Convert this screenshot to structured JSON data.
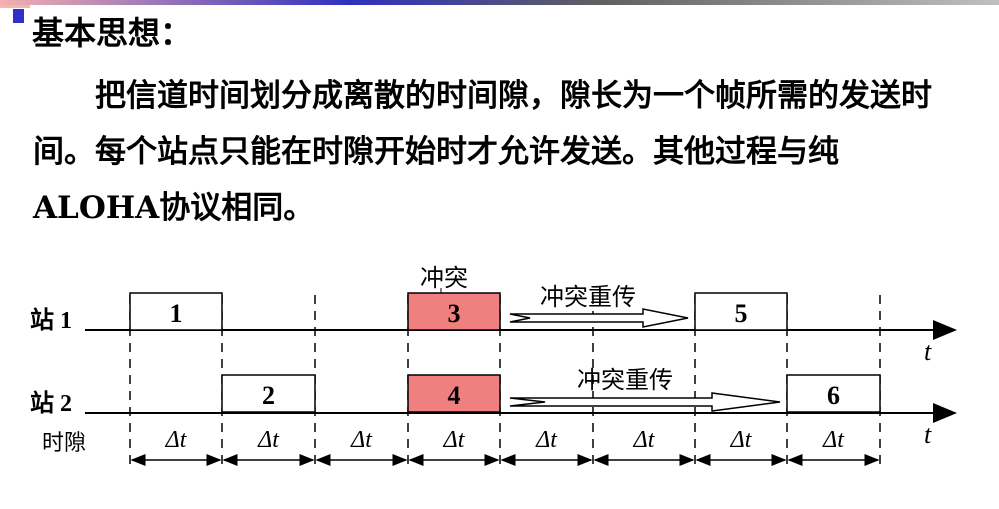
{
  "title": "基本思想：",
  "paragraph": "把信道时间划分成离散的时间隙，隙长为一个帧所需的发送时间。每个站点只能在时隙开始时才允许发送。其他过程与纯ALOHA协议相同。",
  "diagram": {
    "station1_label": "站 1",
    "station2_label": "站 2",
    "slot_label": "时隙",
    "time_label": "t",
    "delta_label": "Δt",
    "collision_label": "冲突",
    "retransmit_label": "冲突重传",
    "frames": [
      "1",
      "2",
      "3",
      "4",
      "5",
      "6"
    ],
    "collision_color": "#f08080"
  }
}
